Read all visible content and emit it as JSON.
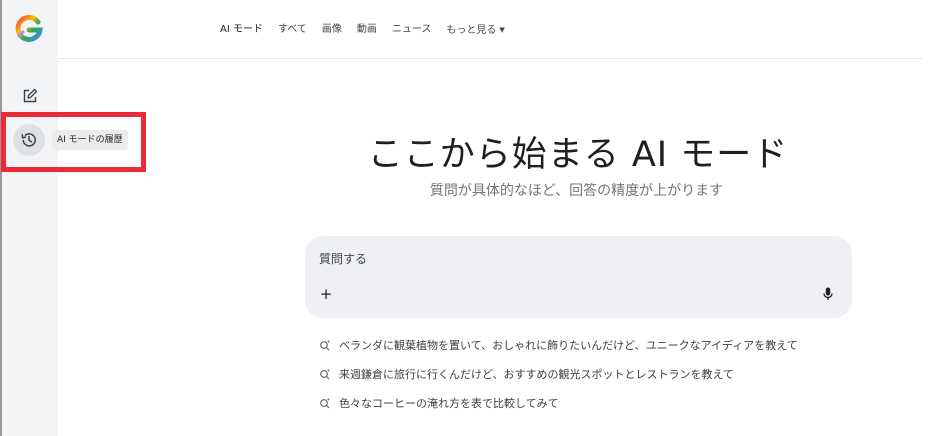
{
  "sidebar": {
    "logo_icon": "google-g-logo-icon",
    "new_chat_icon": "edit-square-icon",
    "history_icon": "history-clock-icon",
    "history_tooltip": "AI モードの履歴"
  },
  "topnav": {
    "tabs": [
      {
        "label": "AI モード",
        "active": true
      },
      {
        "label": "すべて"
      },
      {
        "label": "画像"
      },
      {
        "label": "動画"
      },
      {
        "label": "ニュース"
      },
      {
        "label": "もっと見る"
      }
    ]
  },
  "hero": {
    "title": "ここから始まる AI モード",
    "subtitle": "質問が具体的なほど、回答の精度が上がります"
  },
  "search": {
    "placeholder": "質問する",
    "plus_label": "+",
    "mic_icon": "microphone-icon"
  },
  "suggestions": [
    "ベランダに観葉植物を置いて、おしゃれに飾りたいんだけど、ユニークなアイディアを教えて",
    "来週鎌倉に旅行に行くんだけど、おすすめの観光スポットとレストランを教えて",
    "色々なコーヒーの淹れ方を表で比較してみて"
  ],
  "colors": {
    "highlight": "#ea2a36",
    "sidebar_bg": "#f3f4f6",
    "search_bg": "#eef0f3"
  }
}
